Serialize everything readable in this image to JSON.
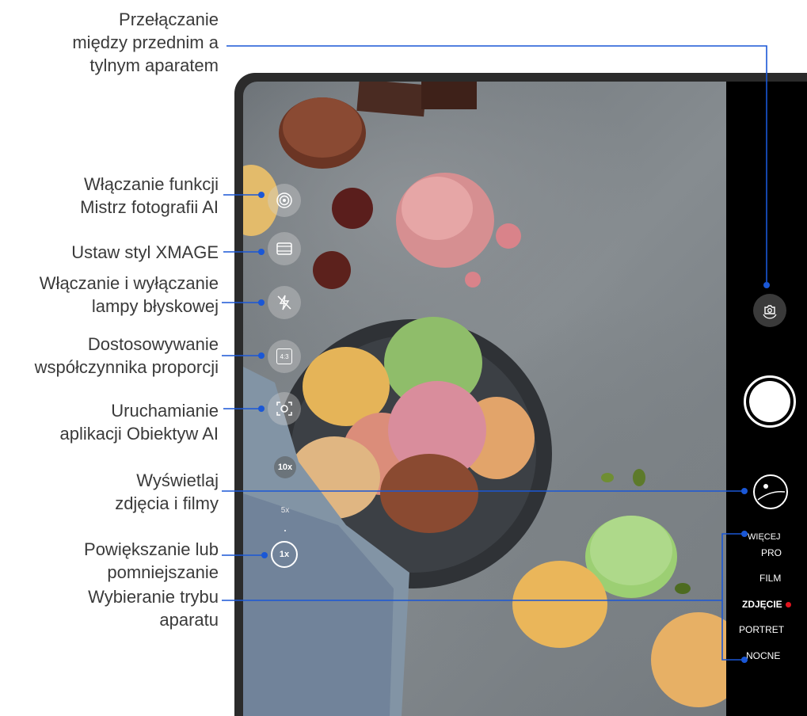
{
  "annotations": {
    "switch_camera": [
      "Przełączanie",
      "między przednim a",
      "tylnym aparatem"
    ],
    "ai_master": [
      "Włączanie funkcji",
      "Mistrz fotografii AI"
    ],
    "xmage": [
      "Ustaw styl XMAGE"
    ],
    "flash": [
      "Włączanie i wyłączanie",
      "lampy błyskowej"
    ],
    "aspect": [
      "Dostosowywanie",
      "współczynnika proporcji"
    ],
    "ai_lens": [
      "Uruchamianie",
      "aplikacji Obiektyw AI"
    ],
    "gallery": [
      "Wyświetlaj",
      "zdjęcia i filmy"
    ],
    "zoom": [
      "Powiększanie lub",
      "pomniejszanie"
    ],
    "mode": [
      "Wybieranie trybu",
      "aparatu"
    ]
  },
  "camera": {
    "aspect_label": "4:3",
    "zoom_levels": [
      "10x",
      "5x",
      "1x"
    ],
    "modes": [
      "WIĘCEJ",
      "PRO",
      "FILM",
      "ZDJĘCIE",
      "PORTRET",
      "NOCNE"
    ],
    "active_mode": "ZDJĘCIE"
  },
  "colors": {
    "leader_line": "#1a57d6",
    "active_indicator": "#e0141e"
  }
}
